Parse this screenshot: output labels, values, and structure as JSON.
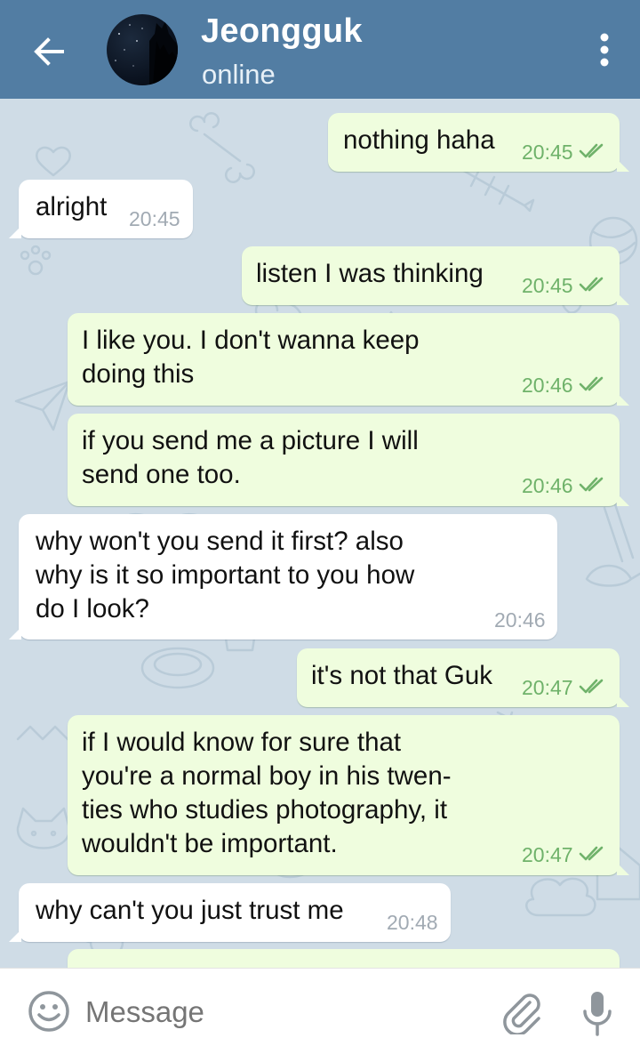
{
  "header": {
    "contact_name": "Jeongguk",
    "status": "online"
  },
  "messages": [
    {
      "direction": "out",
      "text": "nothing haha",
      "time": "20:45",
      "read": true
    },
    {
      "direction": "in",
      "text": "alright",
      "time": "20:45"
    },
    {
      "direction": "out",
      "text": "listen I was thinking",
      "time": "20:45",
      "read": true
    },
    {
      "direction": "out",
      "lines": [
        "I like you. I don't wanna keep",
        "doing this"
      ],
      "time": "20:46",
      "read": true
    },
    {
      "direction": "out",
      "lines": [
        "if you send me a picture I will",
        "send one too."
      ],
      "time": "20:46",
      "read": true
    },
    {
      "direction": "in",
      "lines": [
        "why won't you send it first? also",
        "why is it so important to you how",
        "do I look?"
      ],
      "time": "20:46"
    },
    {
      "direction": "out",
      "text": "it's not that Guk",
      "time": "20:47",
      "read": true
    },
    {
      "direction": "out",
      "lines": [
        "if I would know for sure that",
        "you're a normal boy in his twen-",
        "ties who studies photography, it",
        "wouldn't be important."
      ],
      "time": "20:47",
      "read": true
    },
    {
      "direction": "in",
      "text": "why can't you just trust me",
      "time": "20:48"
    }
  ],
  "input": {
    "placeholder": "Message"
  },
  "icons": {
    "back": "arrow-left-icon",
    "menu": "more-vertical-icon",
    "emoji": "smiley-icon",
    "attach": "paperclip-icon",
    "mic": "microphone-icon",
    "read_receipt": "double-check-icon"
  },
  "colors": {
    "header": "#527da3",
    "outgoing_bubble": "#effdde",
    "incoming_bubble": "#ffffff",
    "outgoing_time": "#6fb26a",
    "incoming_time": "#a1aab3",
    "chat_background": "#cfdce6"
  }
}
